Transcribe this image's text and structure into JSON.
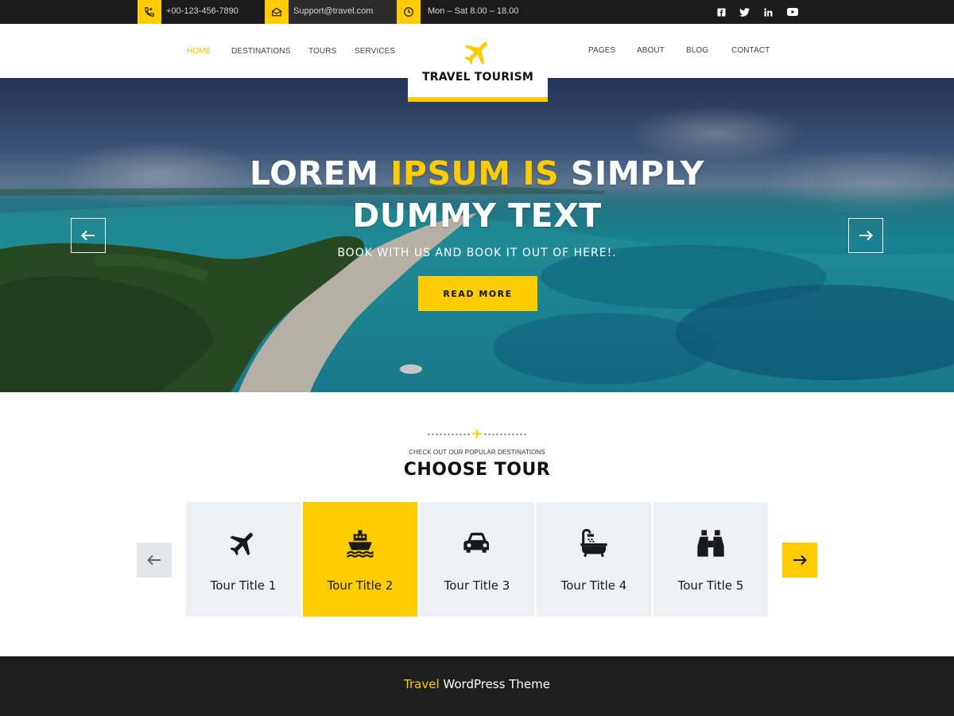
{
  "topbar": {
    "phone": "+00-123-456-7890",
    "email": "Support@travel.com",
    "hours": "Mon – Sat 8.00 – 18.00",
    "icons": [
      "phone-icon",
      "mail-icon",
      "clock-icon"
    ],
    "social": [
      "facebook-icon",
      "twitter-icon",
      "linkedin-icon",
      "youtube-icon"
    ]
  },
  "nav": {
    "left": [
      "HOME",
      "DESTINATIONS",
      "TOURS",
      "SERVICES"
    ],
    "right": [
      "PAGES",
      "ABOUT",
      "BLOG",
      "CONTACT"
    ],
    "active": "HOME"
  },
  "logo": {
    "text": "TRAVEL TOURISM",
    "icon": "airplane-icon"
  },
  "hero": {
    "title_part1": "LOREM ",
    "title_highlight": "IPSUM IS",
    "title_part2": " SIMPLY",
    "title_line2": "DUMMY TEXT",
    "subtitle": "BOOK WITH US AND BOOK IT OUT OF HERE!.",
    "button": "READ MORE"
  },
  "tours": {
    "kicker": "CHECK OUT OUR POPULAR DESTINATIONS",
    "title": "CHOOSE TOUR",
    "cards": [
      {
        "title": "Tour Title 1",
        "icon": "airplane-icon"
      },
      {
        "title": "Tour Title 2",
        "icon": "ship-icon"
      },
      {
        "title": "Tour Title 3",
        "icon": "car-icon"
      },
      {
        "title": "Tour Title 4",
        "icon": "bathtub-icon"
      },
      {
        "title": "Tour Title 5",
        "icon": "binoculars-icon"
      }
    ],
    "active_index": 1
  },
  "footer": {
    "highlight": "Travel",
    "text": " WordPress Theme"
  },
  "colors": {
    "accent": "#ffcc00",
    "dark": "#1b1b1b",
    "card": "#edf1f4"
  }
}
